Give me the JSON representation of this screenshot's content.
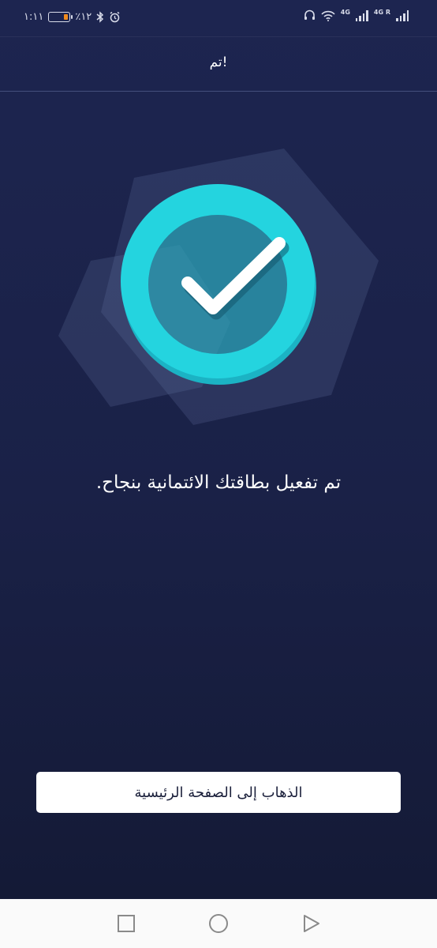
{
  "status_bar": {
    "time": "١:١١",
    "battery_percent": "٪١٢",
    "battery_level": 0.12,
    "network_1": "4G",
    "network_2": "4G R",
    "icons": [
      "battery-icon",
      "bluetooth-icon",
      "alarm-icon",
      "headset-icon",
      "wifi-icon",
      "signal-icon"
    ]
  },
  "header": {
    "title": "تم!"
  },
  "illustration": {
    "icon": "checkmark-icon",
    "colors": {
      "ring": "#24d4df",
      "ring_shadow": "#1bb3c4",
      "inner": "#1f7c96",
      "hexagon": "#5a6a98"
    }
  },
  "message": {
    "text": "تم تفعيل بطاقتك الائتمانية بنجاح."
  },
  "primary_button": {
    "label": "الذهاب إلى الصفحة الرئيسية"
  },
  "nav_bar": {
    "icons": [
      "recent-apps-icon",
      "home-icon",
      "back-icon"
    ]
  },
  "colors": {
    "background": "#1b2244",
    "button_bg": "#ffffff",
    "button_text": "#1a1f3a",
    "battery_low": "#f08a1c"
  }
}
